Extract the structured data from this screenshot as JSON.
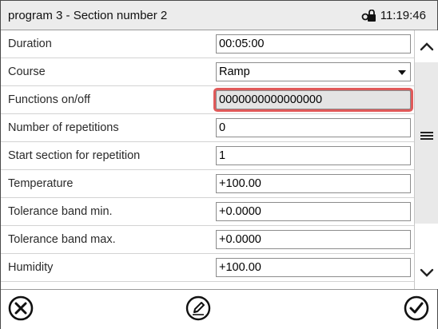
{
  "header": {
    "title": "program 3 - Section number 2",
    "time": "11:19:46"
  },
  "rows": [
    {
      "label": "Duration",
      "value": "00:05:00",
      "kind": "input"
    },
    {
      "label": "Course",
      "value": "Ramp",
      "kind": "select"
    },
    {
      "label": "Functions on/off",
      "value": "0000000000000000",
      "kind": "input-active"
    },
    {
      "label": "Number of repetitions",
      "value": "0",
      "kind": "input"
    },
    {
      "label": "Start section for repetition",
      "value": "1",
      "kind": "input"
    },
    {
      "label": "Temperature",
      "value": "+100.00",
      "kind": "input"
    },
    {
      "label": "Tolerance band min.",
      "value": "+0.0000",
      "kind": "input"
    },
    {
      "label": "Tolerance band max.",
      "value": "+0.0000",
      "kind": "input"
    },
    {
      "label": "Humidity",
      "value": "+100.00",
      "kind": "input"
    }
  ],
  "icons": {
    "lock": "lock-icon",
    "scroll_up": "chevron-up-icon",
    "scroll_handle": "menu-lines-icon",
    "scroll_down": "chevron-down-icon",
    "cancel": "cancel-circle-icon",
    "edit": "pencil-circle-icon",
    "confirm": "check-circle-icon"
  },
  "colors": {
    "active_highlight": "#e05a5a",
    "title_bar": "#ececec"
  }
}
